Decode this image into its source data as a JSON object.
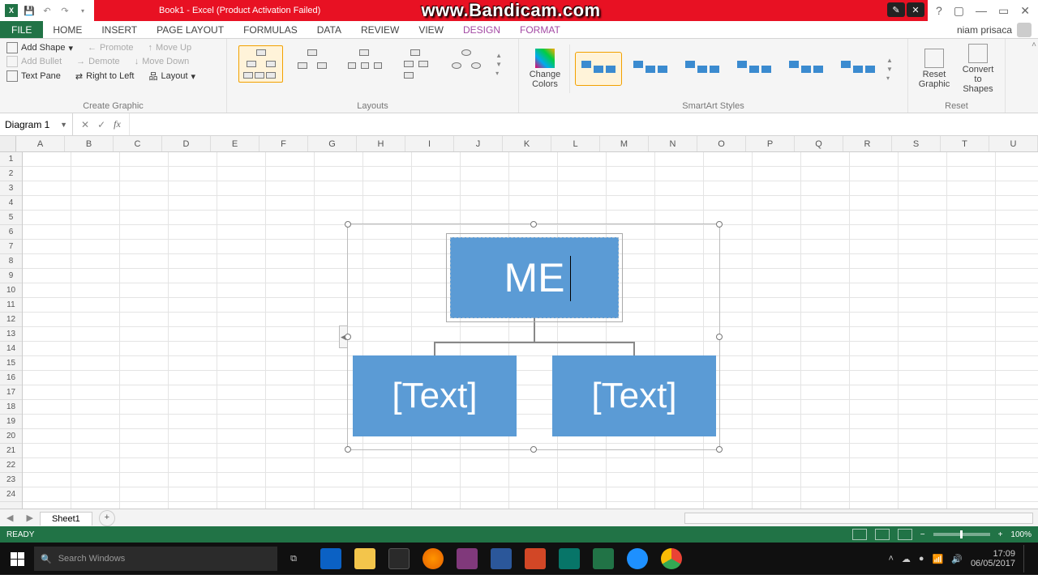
{
  "titlebar": {
    "app_title": "Book1 - Excel (Product Activation Failed)",
    "watermark": "www.Bandicam.com"
  },
  "win": {
    "help": "?",
    "min": "—",
    "max": "▭",
    "close": "✕"
  },
  "tabs": {
    "file": "FILE",
    "home": "HOME",
    "insert": "INSERT",
    "pagelayout": "PAGE LAYOUT",
    "formulas": "FORMULAS",
    "data": "DATA",
    "review": "REVIEW",
    "view": "VIEW",
    "design": "DESIGN",
    "format": "FORMAT",
    "user": "niam prisaca"
  },
  "ribbon": {
    "create_graphic": {
      "title": "Create Graphic",
      "add_shape": "Add Shape",
      "add_bullet": "Add Bullet",
      "text_pane": "Text Pane",
      "promote": "Promote",
      "demote": "Demote",
      "rtl": "Right to Left",
      "move_up": "Move Up",
      "move_down": "Move Down",
      "layout": "Layout"
    },
    "layouts": {
      "title": "Layouts"
    },
    "change_colors": "Change Colors",
    "smartart_styles": {
      "title": "SmartArt Styles"
    },
    "reset": {
      "title": "Reset",
      "reset_graphic": "Reset Graphic",
      "convert": "Convert to Shapes"
    }
  },
  "fbar": {
    "namebox": "Diagram 1",
    "fx": "fx"
  },
  "columns": [
    "A",
    "B",
    "C",
    "D",
    "E",
    "F",
    "G",
    "H",
    "I",
    "J",
    "K",
    "L",
    "M",
    "N",
    "O",
    "P",
    "Q",
    "R",
    "S",
    "T",
    "U"
  ],
  "rows": [
    "1",
    "2",
    "3",
    "4",
    "5",
    "6",
    "7",
    "8",
    "9",
    "10",
    "11",
    "12",
    "13",
    "14",
    "15",
    "16",
    "17",
    "18",
    "19",
    "20",
    "21",
    "22",
    "23",
    "24"
  ],
  "smartart": {
    "top": "ME",
    "bl": "[Text]",
    "br": "[Text]"
  },
  "sheet_tabs": {
    "sheet1": "Sheet1"
  },
  "status": {
    "ready": "READY",
    "zoom": "100%"
  },
  "taskbar": {
    "search_placeholder": "Search Windows",
    "time": "17:09",
    "date": "06/05/2017"
  }
}
